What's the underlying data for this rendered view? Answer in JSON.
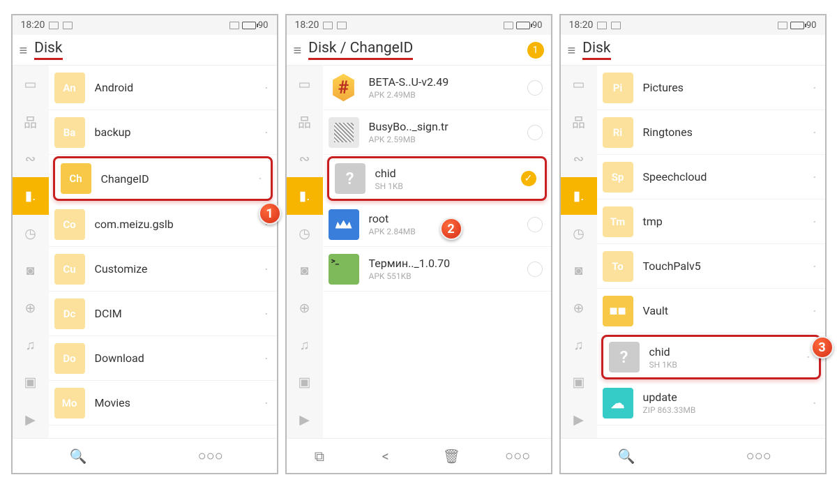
{
  "status": {
    "time": "18:20",
    "battery": "90"
  },
  "panel1": {
    "breadcrumb": "Disk",
    "items": [
      {
        "abbr": "An",
        "name": "Android",
        "cls": "folder dim"
      },
      {
        "abbr": "Ba",
        "name": "backup",
        "cls": "folder dim"
      },
      {
        "abbr": "Ch",
        "name": "ChangeID",
        "cls": "folder",
        "highlight": true
      },
      {
        "abbr": "Co",
        "name": "com.meizu.gslb",
        "cls": "folder dim"
      },
      {
        "abbr": "Cu",
        "name": "Customize",
        "cls": "folder dim"
      },
      {
        "abbr": "Dc",
        "name": "DCIM",
        "cls": "folder dim"
      },
      {
        "abbr": "Do",
        "name": "Download",
        "cls": "folder dim"
      },
      {
        "abbr": "Mo",
        "name": "Movies",
        "cls": "folder dim"
      }
    ],
    "callout": "1"
  },
  "panel2": {
    "breadcrumb": "Disk / ChangeID",
    "selection_count": "1",
    "items": [
      {
        "thumb": "super",
        "name": "BETA-S..U-v2.49",
        "sub": "APK 2.49MB"
      },
      {
        "thumb": "graybox",
        "name": "BusyBo.._sign.tr",
        "sub": "APK 2.59MB"
      },
      {
        "thumb": "gray",
        "name": "chid",
        "sub": "SH 1KB",
        "checked": true,
        "highlight": true
      },
      {
        "thumb": "blue",
        "name": "root",
        "sub": "APK 2.84MB"
      },
      {
        "thumb": "green",
        "name": "Термин.._1.0.70",
        "sub": "APK 551KB"
      }
    ],
    "callout": "2"
  },
  "panel3": {
    "breadcrumb": "Disk",
    "items": [
      {
        "abbr": "Pi",
        "name": "Pictures",
        "cls": "folder dim"
      },
      {
        "abbr": "Ri",
        "name": "Ringtones",
        "cls": "folder dim"
      },
      {
        "abbr": "Sp",
        "name": "Speechcloud",
        "cls": "folder dim"
      },
      {
        "abbr": "Tm",
        "name": "tmp",
        "cls": "folder dim"
      },
      {
        "abbr": "To",
        "name": "TouchPalv5",
        "cls": "folder dim"
      },
      {
        "abbr": "",
        "name": "Vault",
        "cls": "vault",
        "glyph": "■■"
      },
      {
        "abbr": "?",
        "name": "chid",
        "sub": "SH 1KB",
        "cls": "gray",
        "highlight": true
      },
      {
        "abbr": "",
        "name": "update",
        "sub": "ZIP 863.33MB",
        "cls": "cyan",
        "glyph": "☁"
      }
    ],
    "callout": "3"
  },
  "bottom": {
    "search": "search-icon",
    "more": "more-icon",
    "select": "select-icon",
    "share": "share-icon",
    "trash": "trash-icon"
  }
}
